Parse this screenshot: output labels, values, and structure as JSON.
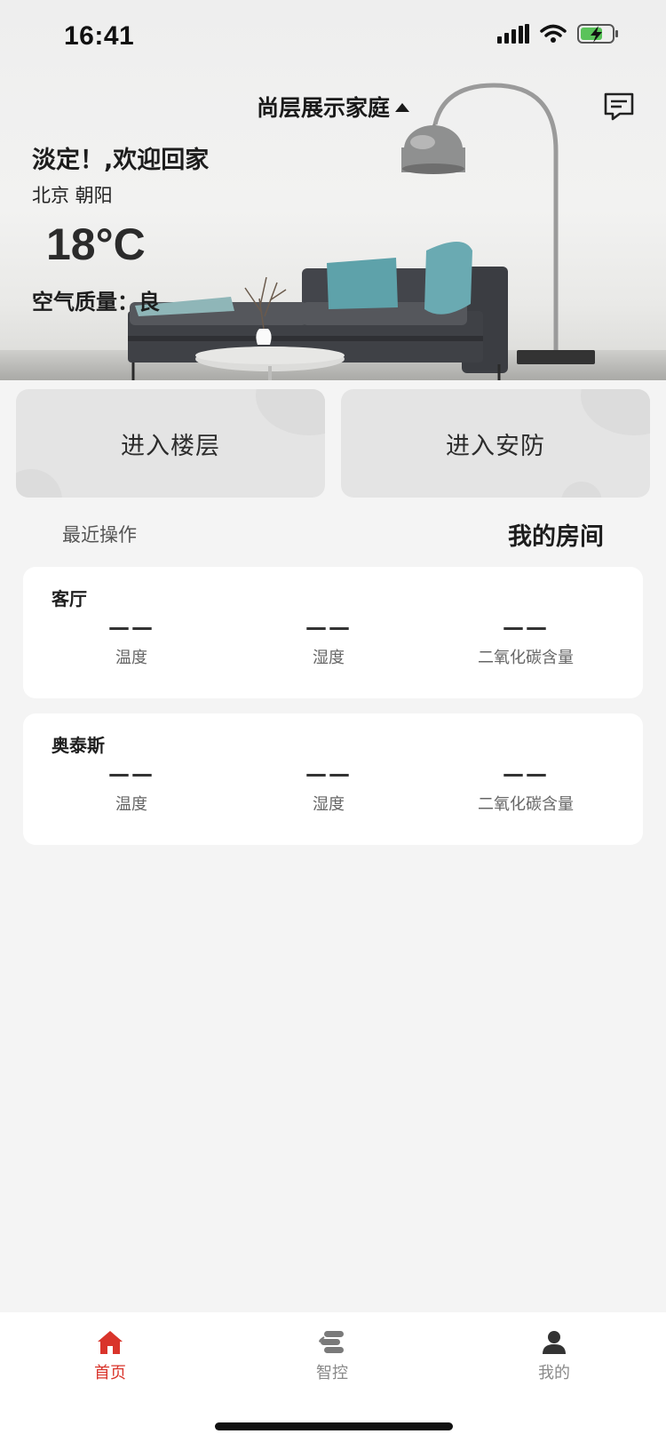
{
  "status_bar": {
    "time": "16:41"
  },
  "header": {
    "home_name": "尚层展示家庭",
    "welcome": "淡定！,欢迎回家",
    "location": "北京 朝阳",
    "temperature": "18°C",
    "air_quality": "空气质量：良"
  },
  "actions": [
    {
      "label": "进入楼层"
    },
    {
      "label": "进入安防"
    }
  ],
  "tabs_header": {
    "recent": "最近操作",
    "rooms": "我的房间"
  },
  "rooms": [
    {
      "name": "客厅",
      "metrics": [
        {
          "value": "——",
          "label": "温度"
        },
        {
          "value": "——",
          "label": "湿度"
        },
        {
          "value": "——",
          "label": "二氧化碳含量"
        }
      ]
    },
    {
      "name": "奥泰斯",
      "metrics": [
        {
          "value": "——",
          "label": "温度"
        },
        {
          "value": "——",
          "label": "湿度"
        },
        {
          "value": "——",
          "label": "二氧化碳含量"
        }
      ]
    }
  ],
  "tabbar": [
    {
      "label": "首页",
      "icon": "home-icon",
      "active": true
    },
    {
      "label": "智控",
      "icon": "smart-control-icon",
      "active": false
    },
    {
      "label": "我的",
      "icon": "user-icon",
      "active": false
    }
  ],
  "colors": {
    "accent": "#d9342b",
    "inactive": "#8a8a8a",
    "background": "#f4f4f4",
    "card": "#ffffff",
    "action_card": "#e4e4e4"
  }
}
